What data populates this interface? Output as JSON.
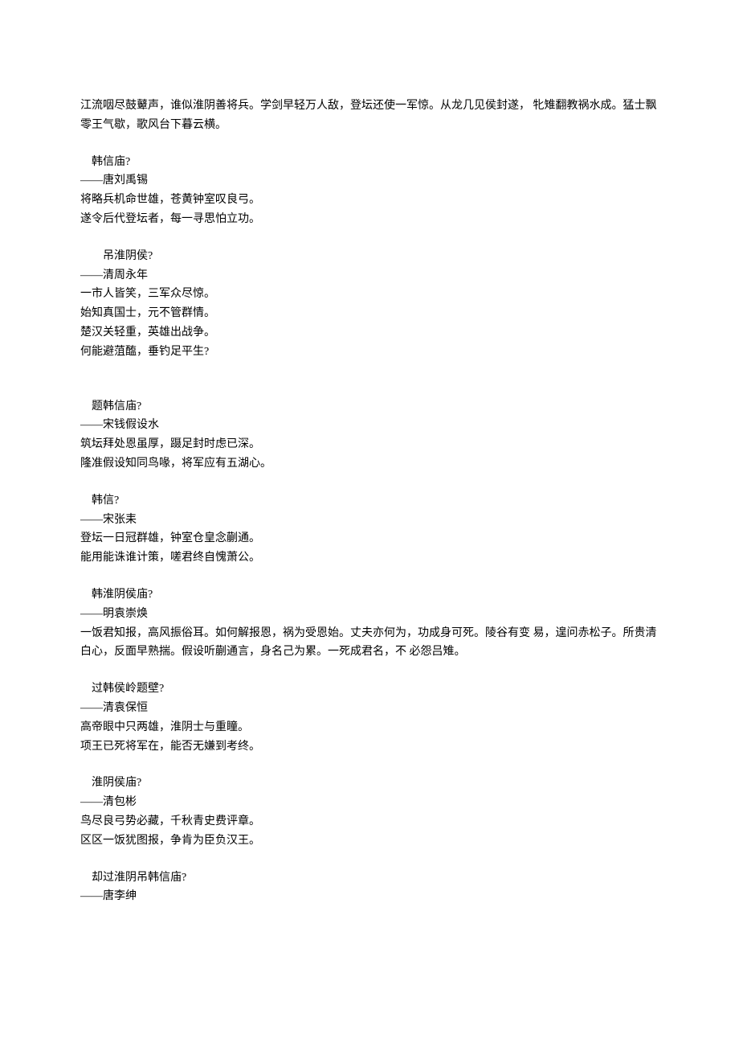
{
  "intro": "江流咽尽鼓鼙声，谁似淮阴善将兵。学剑早轻万人敌，登坛还使一军惊。从龙几见侯封遂，  牝雉翻教祸水成。猛士飘零王气歇，歌风台下暮云横。",
  "poems": [
    {
      "title": "韩信庙?",
      "titleIndent": "normal",
      "author": "——唐刘禹锡",
      "lines": [
        "将略兵机命世雄，苍黄钟室叹良弓。",
        "遂令后代登坛者，每一寻思怕立功。"
      ]
    },
    {
      "title": "吊淮阴侯?",
      "titleIndent": "extra",
      "author": "——清周永年",
      "lines": [
        "一市人皆笑，三军众尽惊。",
        "始知真国士，元不管群情。",
        "楚汉关轻重，英雄出战争。",
        "何能避菹醢，垂钓足平生?"
      ],
      "extraMargin": true
    },
    {
      "title": "题韩信庙?",
      "titleIndent": "normal",
      "author": "——宋钱假设水",
      "lines": [
        "筑坛拜处恩虽厚，蹑足封时虑已深。",
        "隆准假设知同鸟喙，将军应有五湖心。"
      ]
    },
    {
      "title": "韩信?",
      "titleIndent": "normal",
      "author": "——宋张耒",
      "lines": [
        "登坛一日冠群雄，钟室仓皇念蒯通。",
        "能用能诛谁计策，嗟君终自愧萧公。"
      ]
    },
    {
      "title": "韩淮阴侯庙?",
      "titleIndent": "normal",
      "author": "——明袁崇焕",
      "lines": [
        "一饭君知报，高风振俗耳。如何解报恩，祸为受恩始。丈夫亦何为，功成身可死。陵谷有变 易，遑问赤松子。所贵清白心，反面早熟揣。假设听蒯通言，身名己为累。一死成君名，不 必怨吕雉。"
      ]
    },
    {
      "title": "过韩侯岭题壁?",
      "titleIndent": "normal",
      "author": "——清袁保恒",
      "lines": [
        "高帝眼中只两雄，淮阴士与重瞳。",
        "项王已死将军在，能否无嫌到考终。"
      ]
    },
    {
      "title": "淮阴侯庙?",
      "titleIndent": "normal",
      "author": "——清包彬",
      "lines": [
        "鸟尽良弓势必藏，千秋青史费评章。",
        "区区一饭犹图报，争肯为臣负汉王。"
      ]
    },
    {
      "title": "却过淮阴吊韩信庙?",
      "titleIndent": "normal",
      "author": "——唐李绅",
      "lines": []
    }
  ]
}
